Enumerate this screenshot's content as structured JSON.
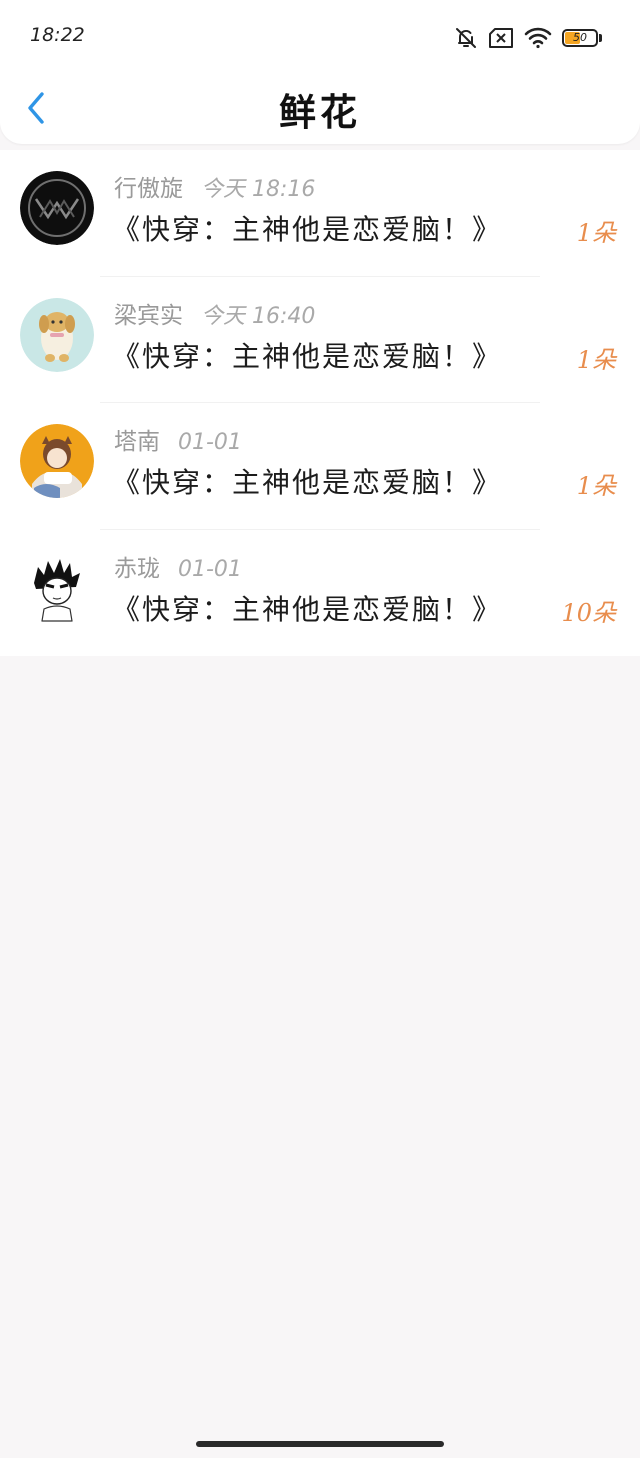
{
  "status_bar": {
    "time": "18:22",
    "battery_level": "50",
    "battery_fraction": 0.5,
    "icons": [
      "bell-muted-icon",
      "sim-off-icon",
      "wifi-icon",
      "battery-icon"
    ]
  },
  "header": {
    "title": "鲜花",
    "back_icon": "chevron-left-icon",
    "accent": "#2f95e6"
  },
  "colors": {
    "count": "#e88d4d",
    "meta": "#9a9a9a",
    "background": "#f8f6f7"
  },
  "gifts": [
    {
      "name": "行傲旋",
      "time": "今天 18:16",
      "book": "《快穿：主神他是恋爱脑！》",
      "count": "1朵"
    },
    {
      "name": "梁宾实",
      "time": "今天 16:40",
      "book": "《快穿：主神他是恋爱脑！》",
      "count": "1朵"
    },
    {
      "name": "塔南",
      "time": "01-01",
      "book": "《快穿：主神他是恋爱脑！》",
      "count": "1朵"
    },
    {
      "name": "赤珑",
      "time": "01-01",
      "book": "《快穿：主神他是恋爱脑！》",
      "count": "10朵"
    }
  ]
}
